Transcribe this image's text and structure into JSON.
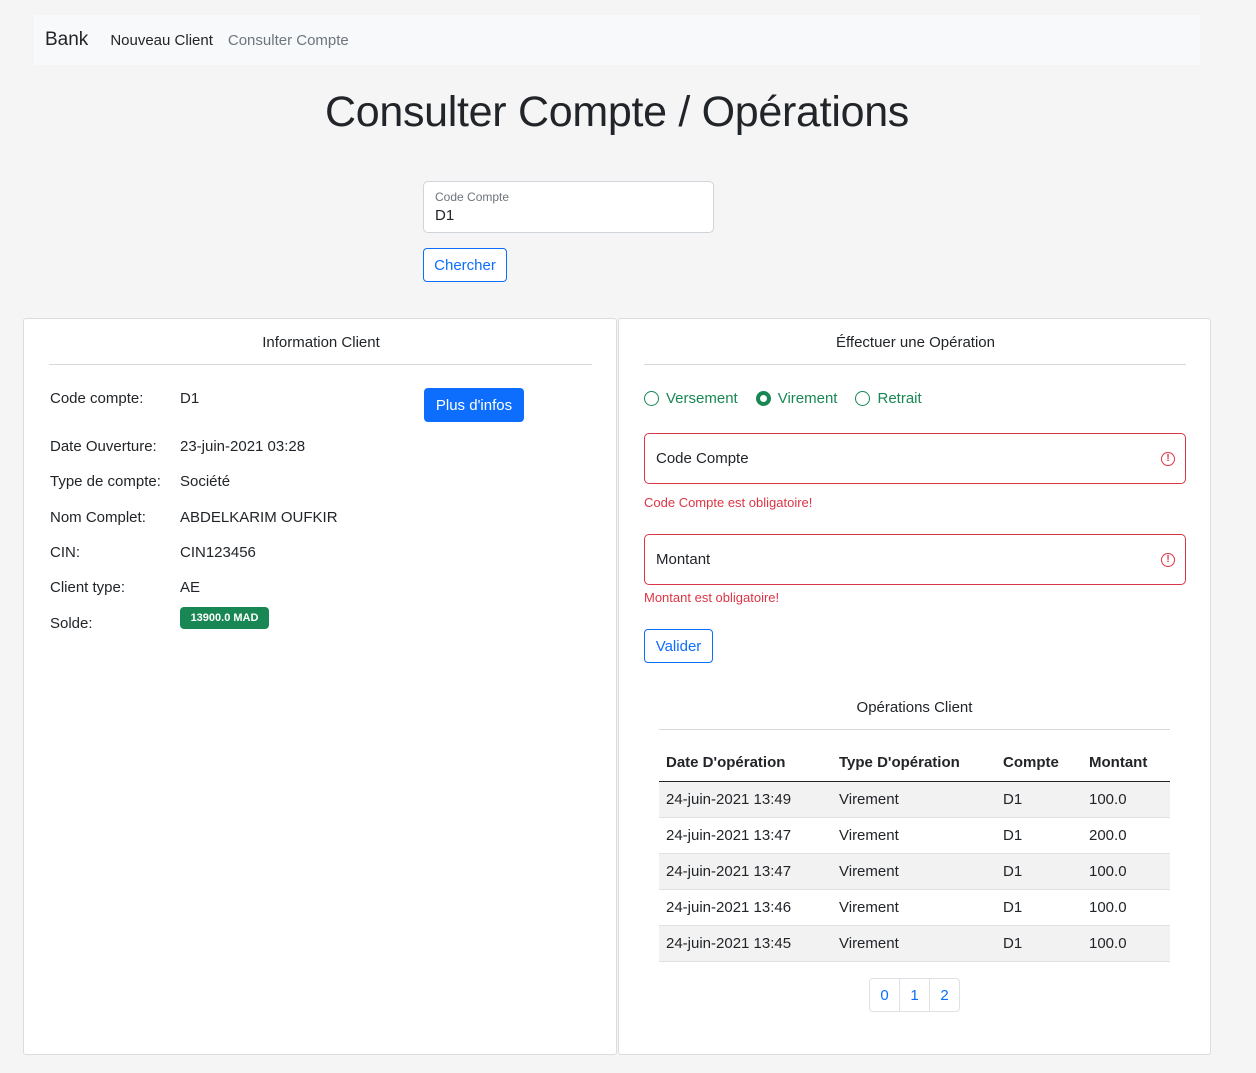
{
  "navbar": {
    "brand": "Bank",
    "links": [
      "Nouveau Client",
      "Consulter Compte"
    ]
  },
  "page_title": "Consulter Compte / Opérations",
  "search": {
    "label": "Code Compte",
    "value": "D1",
    "button": "Chercher"
  },
  "info": {
    "title": "Information Client",
    "more_button": "Plus d'infos",
    "rows": [
      {
        "label": "Code compte:",
        "value": "D1"
      },
      {
        "label": "Date Ouverture:",
        "value": "23-juin-2021 03:28"
      },
      {
        "label": "Type de compte:",
        "value": "Société"
      },
      {
        "label": "Nom Complet:",
        "value": "ABDELKARIM OUFKIR"
      },
      {
        "label": "CIN:",
        "value": "CIN123456"
      },
      {
        "label": "Client type:",
        "value": "AE"
      },
      {
        "label": "Solde:",
        "value": ""
      }
    ],
    "solde_badge": "13900.0 MAD"
  },
  "operation": {
    "title": "Éffectuer une Opération",
    "radios": [
      {
        "label": "Versement",
        "checked": false
      },
      {
        "label": "Virement",
        "checked": true
      },
      {
        "label": "Retrait",
        "checked": false
      }
    ],
    "code_field": "Code Compte",
    "code_error": "Code Compte est obligatoire!",
    "montant_field": "Montant",
    "montant_error": "Montant est obligatoire!",
    "submit": "Valider"
  },
  "operations_table": {
    "title": "Opérations Client",
    "headers": [
      "Date D'opération",
      "Type D'opération",
      "Compte",
      "Montant"
    ],
    "rows": [
      [
        "24-juin-2021 13:49",
        "Virement",
        "D1",
        "100.0"
      ],
      [
        "24-juin-2021 13:47",
        "Virement",
        "D1",
        "200.0"
      ],
      [
        "24-juin-2021 13:47",
        "Virement",
        "D1",
        "100.0"
      ],
      [
        "24-juin-2021 13:46",
        "Virement",
        "D1",
        "100.0"
      ],
      [
        "24-juin-2021 13:45",
        "Virement",
        "D1",
        "100.0"
      ]
    ],
    "pages": [
      "0",
      "1",
      "2"
    ]
  },
  "colors": {
    "primary": "#0d6efd",
    "success": "#198754",
    "danger": "#dc3545"
  }
}
